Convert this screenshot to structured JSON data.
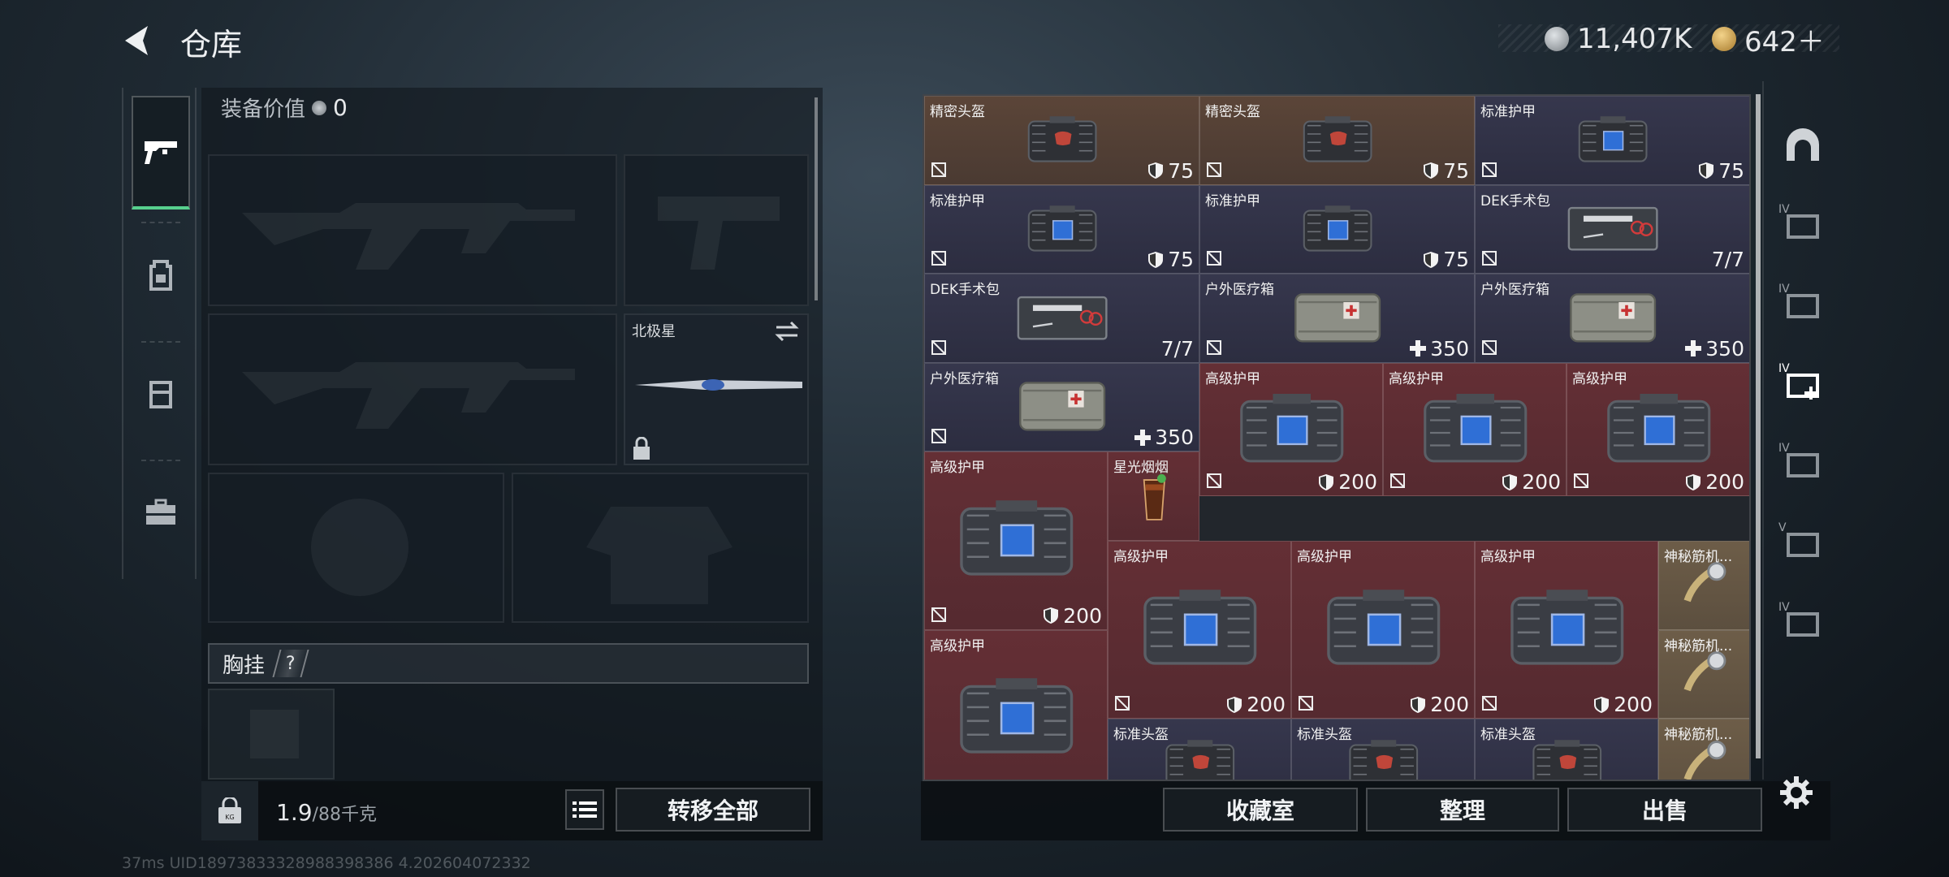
{
  "header": {
    "title": "仓库",
    "currency": {
      "coins": "11,407K",
      "gold": "642＋"
    }
  },
  "equipment": {
    "label": "装备价值",
    "value": "0",
    "pin_slot_name": "北极星",
    "chest_rig_label": "胸挂",
    "help": "?"
  },
  "left_tabs": [
    {
      "name": "weapons"
    },
    {
      "name": "backpack"
    },
    {
      "name": "armor-vest"
    },
    {
      "name": "toolbox"
    }
  ],
  "footer_left": {
    "weight": "1.9",
    "capacity": "/88千克",
    "transfer_all": "转移全部"
  },
  "footer_right": {
    "collection": "收藏室",
    "organize": "整理",
    "sell": "出售"
  },
  "status_line": "37ms   UID18973833328988398386 4.202604072332",
  "inventory": [
    {
      "name": "精密头盔",
      "value": "75",
      "kind": "durability",
      "color": "#5a4537"
    },
    {
      "name": "精密头盔",
      "value": "75",
      "kind": "durability",
      "color": "#5a4537"
    },
    {
      "name": "标准护甲",
      "value": "75",
      "kind": "durability",
      "color": "#34354b"
    },
    {
      "name": "标准护甲",
      "value": "75",
      "kind": "durability",
      "color": "#34354b"
    },
    {
      "name": "标准护甲",
      "value": "75",
      "kind": "durability",
      "color": "#34354b"
    },
    {
      "name": "DEK手术包",
      "value": "7/7",
      "kind": "count",
      "color": "#34354b"
    },
    {
      "name": "DEK手术包",
      "value": "7/7",
      "kind": "count",
      "color": "#34354b"
    },
    {
      "name": "户外医疗箱",
      "value": "350",
      "kind": "heal",
      "color": "#34354b"
    },
    {
      "name": "户外医疗箱",
      "value": "350",
      "kind": "heal",
      "color": "#34354b"
    },
    {
      "name": "户外医疗箱",
      "value": "350",
      "kind": "heal",
      "color": "#34354b"
    },
    {
      "name": "高级护甲",
      "value": "200",
      "kind": "durability",
      "color": "#62303a"
    },
    {
      "name": "高级护甲",
      "value": "200",
      "kind": "durability",
      "color": "#62303a"
    },
    {
      "name": "高级护甲",
      "value": "200",
      "kind": "durability",
      "color": "#62303a"
    },
    {
      "name": "高级护甲",
      "value": "200",
      "kind": "durability",
      "color": "#62303a"
    },
    {
      "name": "星光烟烟",
      "value": "",
      "kind": "none",
      "color": "#62303a"
    },
    {
      "name": "高级护甲",
      "value": "200",
      "kind": "durability",
      "color": "#62303a"
    },
    {
      "name": "高级护甲",
      "value": "200",
      "kind": "durability",
      "color": "#62303a"
    },
    {
      "name": "高级护甲",
      "value": "200",
      "kind": "durability",
      "color": "#62303a"
    },
    {
      "name": "神秘筋机...",
      "value": "",
      "kind": "none",
      "color": "#6b5c47"
    },
    {
      "name": "神秘筋机...",
      "value": "",
      "kind": "none",
      "color": "#6b5c47"
    },
    {
      "name": "高级护甲",
      "value": "",
      "kind": "none",
      "color": "#62303a"
    },
    {
      "name": "标准头盔",
      "value": "",
      "kind": "none",
      "color": "#34354b"
    },
    {
      "name": "标准头盔",
      "value": "",
      "kind": "none",
      "color": "#34354b"
    },
    {
      "name": "标准头盔",
      "value": "",
      "kind": "none",
      "color": "#34354b"
    },
    {
      "name": "神秘筋机...",
      "value": "",
      "kind": "none",
      "color": "#6b5c47"
    }
  ],
  "right_filters": [
    {
      "tier": "",
      "icon": "helmet-filter-icon"
    },
    {
      "tier": "IV",
      "icon": "armor-filter-icon"
    },
    {
      "tier": "IV",
      "icon": "weapon-filter-icon"
    },
    {
      "tier": "IV",
      "icon": "medkit-filter-icon"
    },
    {
      "tier": "IV",
      "icon": "ammo-filter-icon"
    },
    {
      "tier": "V",
      "icon": "key-filter-icon"
    },
    {
      "tier": "IV",
      "icon": "misc-filter-icon"
    }
  ]
}
